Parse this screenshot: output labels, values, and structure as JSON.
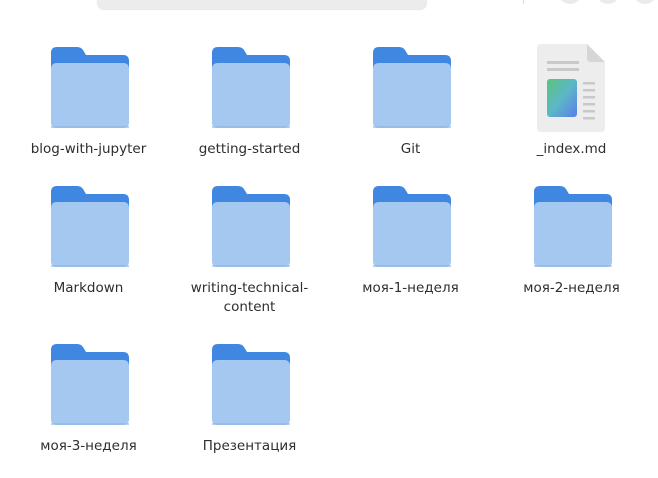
{
  "colors": {
    "folder_back": "#3f87e0",
    "folder_front": "#a4c8f0",
    "text": "#2e2e2e"
  },
  "files": [
    {
      "name": "blog-with-jupyter",
      "type": "folder",
      "icon": "folder-icon"
    },
    {
      "name": "getting-started",
      "type": "folder",
      "icon": "folder-icon"
    },
    {
      "name": "Git",
      "type": "folder",
      "icon": "folder-icon"
    },
    {
      "name": "_index.md",
      "type": "file",
      "icon": "markdown-file-icon"
    },
    {
      "name": "Markdown",
      "type": "folder",
      "icon": "folder-icon"
    },
    {
      "name": "writing-technical-\ncontent",
      "type": "folder",
      "icon": "folder-icon"
    },
    {
      "name": "моя-1-неделя",
      "type": "folder",
      "icon": "folder-icon"
    },
    {
      "name": "моя-2-неделя",
      "type": "folder",
      "icon": "folder-icon"
    },
    {
      "name": "моя-3-неделя",
      "type": "folder",
      "icon": "folder-icon"
    },
    {
      "name": "Презентация",
      "type": "folder",
      "icon": "folder-icon"
    }
  ]
}
